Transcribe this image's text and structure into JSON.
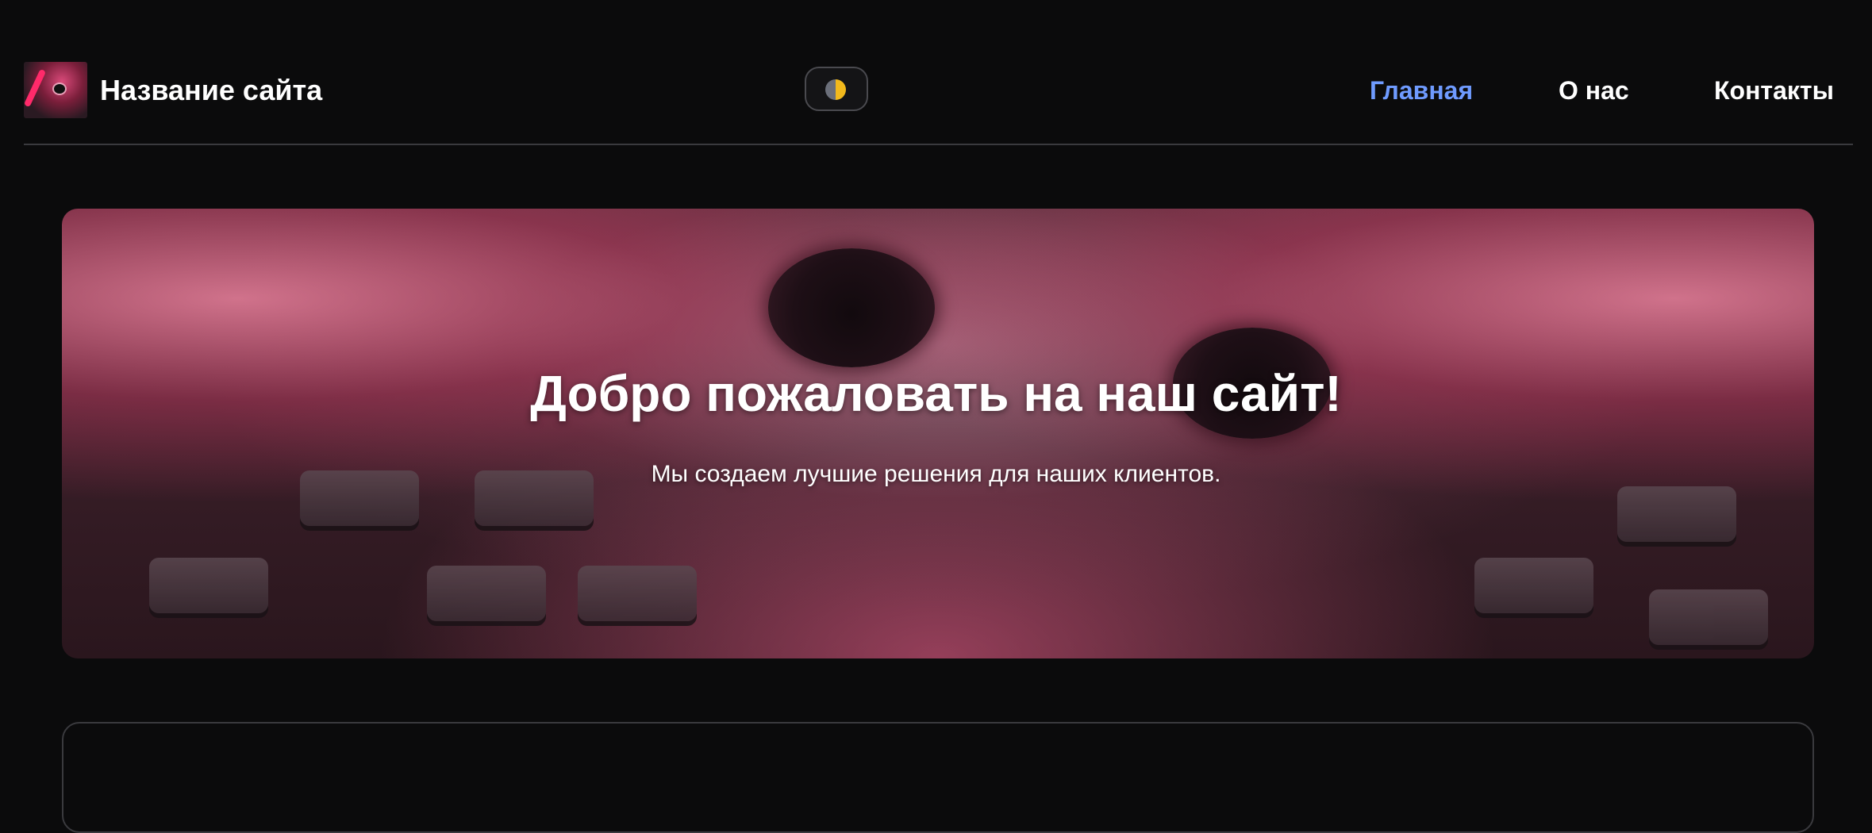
{
  "header": {
    "site_title": "Название сайта",
    "logo_icon": "cat-logo-icon",
    "theme_toggle_icon": "half-moon-icon",
    "nav": [
      {
        "label": "Главная",
        "active": true
      },
      {
        "label": "О нас",
        "active": false
      },
      {
        "label": "Контакты",
        "active": false
      }
    ]
  },
  "hero": {
    "title": "Добро пожаловать на наш сайт!",
    "subtitle": "Мы создаем лучшие решения для наших клиентов."
  },
  "colors": {
    "background": "#0b0b0c",
    "active_nav": "#6f9bff",
    "text": "#ffffff",
    "border": "#3a3a3e"
  }
}
